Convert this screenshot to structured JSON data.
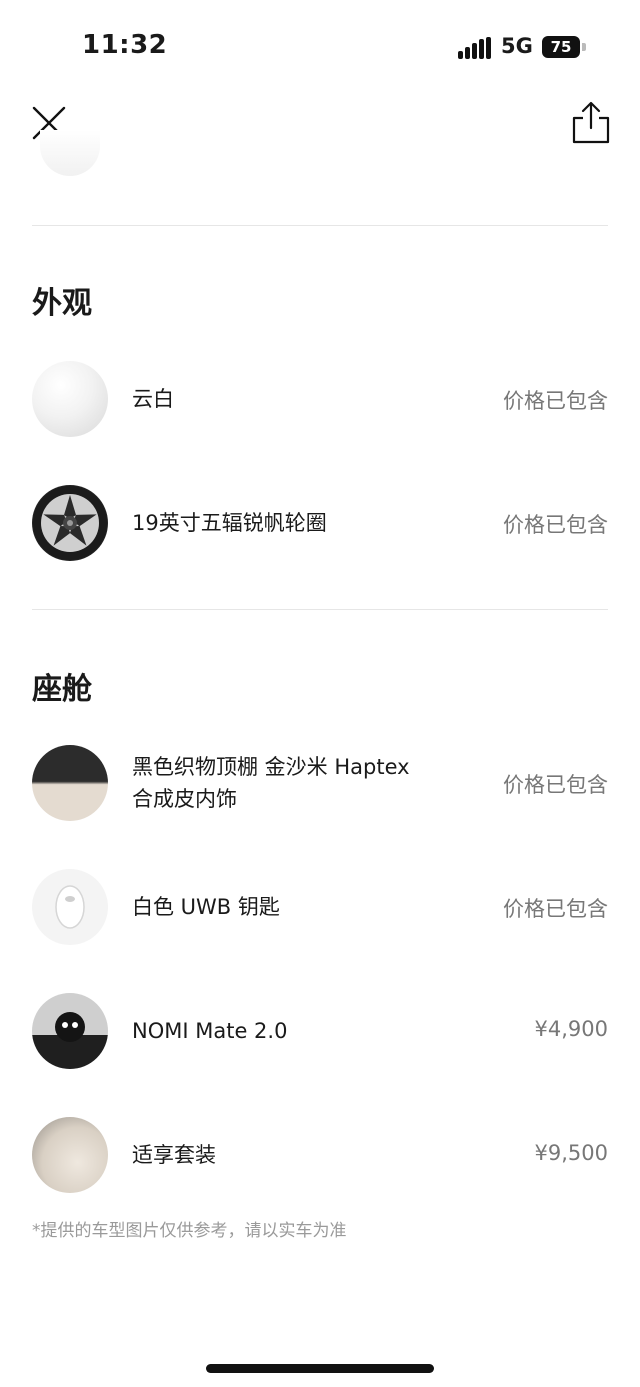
{
  "status_bar": {
    "time": "11:32",
    "network": "5G",
    "battery": "75"
  },
  "sections": {
    "exterior": {
      "title": "外观",
      "items": [
        {
          "label": "云白",
          "price": "价格已包含"
        },
        {
          "label": "19英寸五辐锐帆轮圈",
          "price": "价格已包含"
        }
      ]
    },
    "cabin": {
      "title": "座舱",
      "items": [
        {
          "label_line1": "黑色织物顶棚 金沙米 Haptex",
          "label_line2": "合成皮内饰",
          "price": "价格已包含"
        },
        {
          "label": "白色 UWB 钥匙",
          "price": "价格已包含"
        },
        {
          "label": "NOMI Mate 2.0",
          "price": "¥4,900"
        },
        {
          "label": "适享套装",
          "price": "¥9,500"
        }
      ]
    }
  },
  "note": "*提供的车型图片仅供参考，请以实车为准",
  "icons": [
    "close-icon",
    "share-icon"
  ]
}
